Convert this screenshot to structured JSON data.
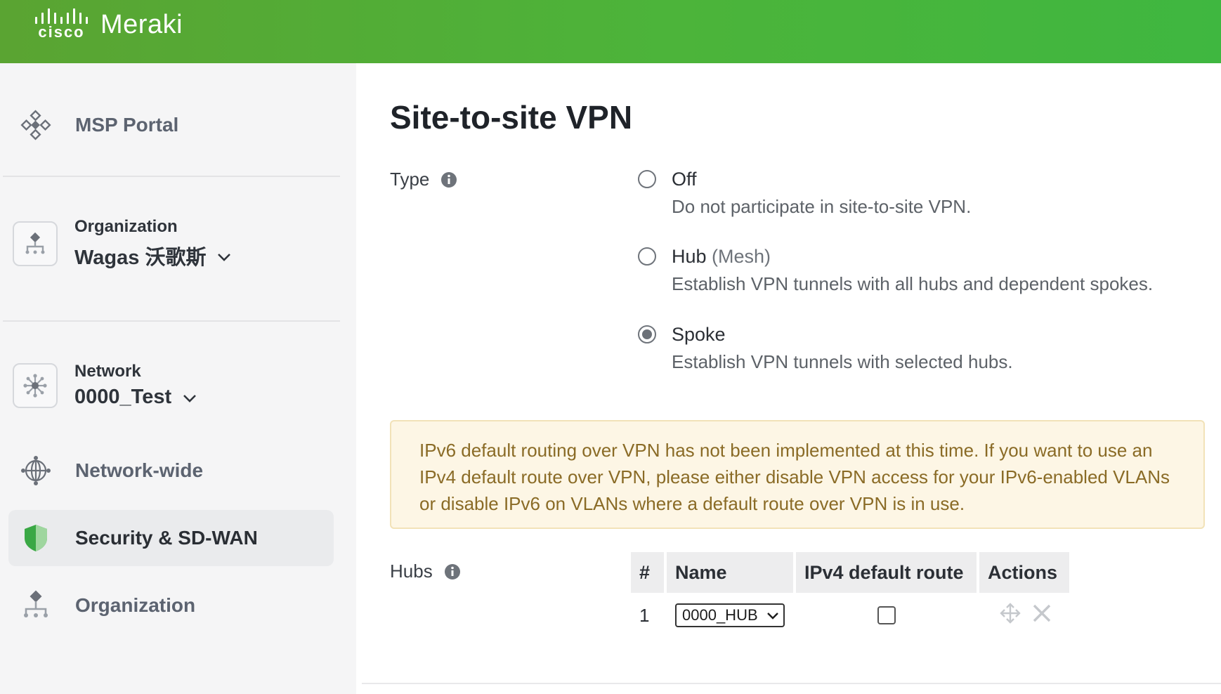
{
  "header": {
    "cisco_text": "cisco",
    "product": "Meraki",
    "brand_color": "#4cb43a"
  },
  "sidebar": {
    "msp_portal": {
      "label": "MSP Portal",
      "icon": "diamond-grid-icon"
    },
    "organization_selector": {
      "caption": "Organization",
      "value": "Wagas 沃歌斯",
      "icon": "org-tree-icon"
    },
    "network_selector": {
      "caption": "Network",
      "value": "0000_Test",
      "icon": "network-hub-icon"
    },
    "items": [
      {
        "label": "Network-wide",
        "icon": "globe-network-icon",
        "active": false
      },
      {
        "label": "Security & SD-WAN",
        "icon": "shield-icon",
        "active": true
      },
      {
        "label": "Organization",
        "icon": "org-tree-icon",
        "active": false
      }
    ]
  },
  "main": {
    "title": "Site-to-site VPN",
    "type_label": "Type",
    "type_options": [
      {
        "title": "Off",
        "suffix": "",
        "description": "Do not participate in site-to-site VPN.",
        "checked": false
      },
      {
        "title": "Hub",
        "suffix": " (Mesh)",
        "description": "Establish VPN tunnels with all hubs and dependent spokes.",
        "checked": false
      },
      {
        "title": "Spoke",
        "suffix": "",
        "description": "Establish VPN tunnels with selected hubs.",
        "checked": true
      }
    ],
    "notice": "IPv6 default routing over VPN has not been implemented at this time. If you want to use an IPv4 default route over VPN, please either disable VPN access for your IPv6-enabled VLANs or disable IPv6 on VLANs where a default route over VPN is in use.",
    "hubs_label": "Hubs",
    "hubs_table": {
      "headers": [
        "#",
        "Name",
        "IPv4 default route",
        "Actions"
      ],
      "rows": [
        {
          "index": "1",
          "name": "0000_HUB",
          "ipv4_default_route": false
        }
      ]
    }
  }
}
